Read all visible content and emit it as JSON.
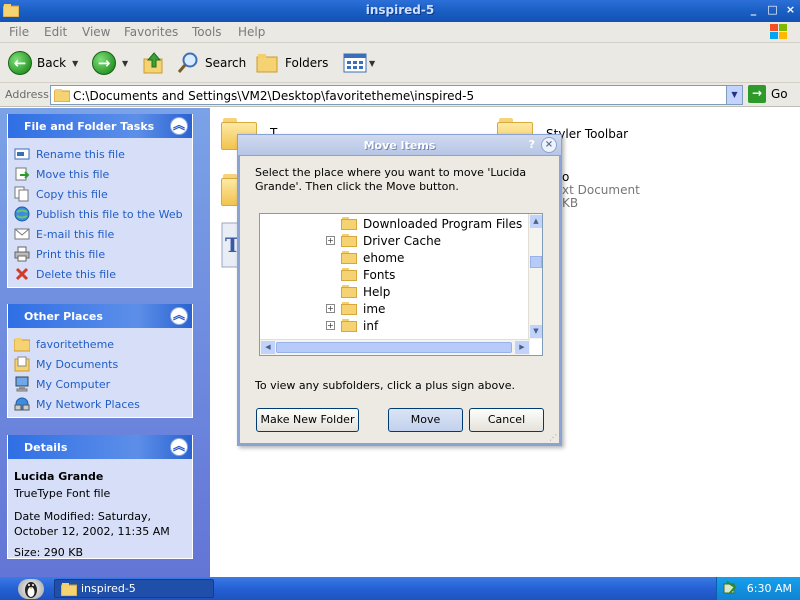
{
  "window": {
    "title": "inspired-5",
    "controls": {
      "minimize": "_",
      "maximize": "□",
      "close": "×"
    }
  },
  "menu": [
    "File",
    "Edit",
    "View",
    "Favorites",
    "Tools",
    "Help"
  ],
  "toolbar": {
    "back": "Back",
    "search": "Search",
    "folders": "Folders"
  },
  "address": {
    "label": "Address",
    "path": "C:\\Documents and Settings\\VM2\\Desktop\\favoritetheme\\inspired-5",
    "go": "Go"
  },
  "tasks_panel": {
    "title": "File and Folder Tasks",
    "items": [
      {
        "label": "Rename this file",
        "icon": "rename-icon"
      },
      {
        "label": "Move this file",
        "icon": "move-icon"
      },
      {
        "label": "Copy this file",
        "icon": "copy-icon"
      },
      {
        "label": "Publish this file to the Web",
        "icon": "globe-icon"
      },
      {
        "label": "E-mail this file",
        "icon": "email-icon"
      },
      {
        "label": "Print this file",
        "icon": "printer-icon"
      },
      {
        "label": "Delete this file",
        "icon": "delete-x-icon"
      }
    ]
  },
  "places_panel": {
    "title": "Other Places",
    "items": [
      {
        "label": "favoritetheme",
        "icon": "folder-icon"
      },
      {
        "label": "My Documents",
        "icon": "documents-icon"
      },
      {
        "label": "My Computer",
        "icon": "computer-icon"
      },
      {
        "label": "My Network Places",
        "icon": "network-icon"
      }
    ]
  },
  "details_panel": {
    "title": "Details",
    "name": "Lucida Grande",
    "type": "TrueType Font file",
    "modified": "Date Modified: Saturday, October 12, 2002, 11:35 AM",
    "size": "Size: 290 KB"
  },
  "content": {
    "item1_partial": "T",
    "item2": "Styler Toolbar",
    "item3_line1": "o",
    "item3_line2": "xt Document",
    "item3_line3": "KB"
  },
  "dialog": {
    "title": "Move Items",
    "help": "?",
    "close": "×",
    "message": "Select the place where you want to move 'Lucida Grande'. Then click the Move button.",
    "tree": [
      {
        "label": "Downloaded Program Files",
        "expandable": false
      },
      {
        "label": "Driver Cache",
        "expandable": true
      },
      {
        "label": "ehome",
        "expandable": false
      },
      {
        "label": "Fonts",
        "expandable": false
      },
      {
        "label": "Help",
        "expandable": false
      },
      {
        "label": "ime",
        "expandable": true
      },
      {
        "label": "inf",
        "expandable": true
      }
    ],
    "hint": "To view any subfolders, click a plus sign above.",
    "buttons": {
      "new_folder": "Make New Folder",
      "move": "Move",
      "cancel": "Cancel"
    }
  },
  "taskbar": {
    "task": "inspired-5",
    "clock": "6:30 AM"
  }
}
